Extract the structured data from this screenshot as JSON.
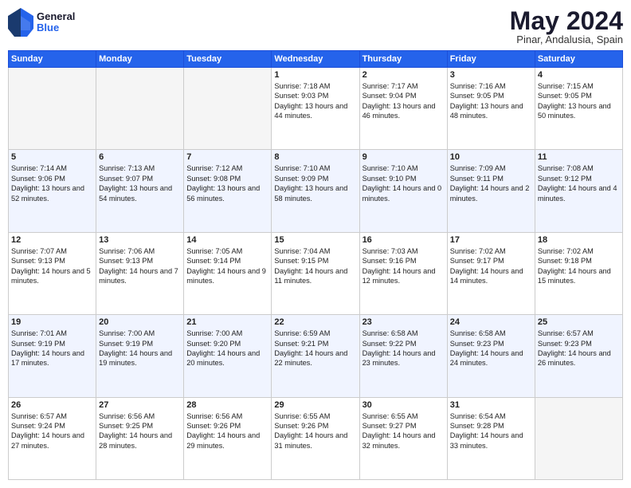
{
  "header": {
    "logo_general": "General",
    "logo_blue": "Blue",
    "title_month": "May 2024",
    "title_location": "Pinar, Andalusia, Spain"
  },
  "weekdays": [
    "Sunday",
    "Monday",
    "Tuesday",
    "Wednesday",
    "Thursday",
    "Friday",
    "Saturday"
  ],
  "weeks": [
    [
      {
        "day": "",
        "empty": true
      },
      {
        "day": "",
        "empty": true
      },
      {
        "day": "",
        "empty": true
      },
      {
        "day": "1",
        "rise": "Sunrise: 7:18 AM",
        "set": "Sunset: 9:03 PM",
        "light": "Daylight: 13 hours and 44 minutes."
      },
      {
        "day": "2",
        "rise": "Sunrise: 7:17 AM",
        "set": "Sunset: 9:04 PM",
        "light": "Daylight: 13 hours and 46 minutes."
      },
      {
        "day": "3",
        "rise": "Sunrise: 7:16 AM",
        "set": "Sunset: 9:05 PM",
        "light": "Daylight: 13 hours and 48 minutes."
      },
      {
        "day": "4",
        "rise": "Sunrise: 7:15 AM",
        "set": "Sunset: 9:05 PM",
        "light": "Daylight: 13 hours and 50 minutes."
      }
    ],
    [
      {
        "day": "5",
        "rise": "Sunrise: 7:14 AM",
        "set": "Sunset: 9:06 PM",
        "light": "Daylight: 13 hours and 52 minutes."
      },
      {
        "day": "6",
        "rise": "Sunrise: 7:13 AM",
        "set": "Sunset: 9:07 PM",
        "light": "Daylight: 13 hours and 54 minutes."
      },
      {
        "day": "7",
        "rise": "Sunrise: 7:12 AM",
        "set": "Sunset: 9:08 PM",
        "light": "Daylight: 13 hours and 56 minutes."
      },
      {
        "day": "8",
        "rise": "Sunrise: 7:10 AM",
        "set": "Sunset: 9:09 PM",
        "light": "Daylight: 13 hours and 58 minutes."
      },
      {
        "day": "9",
        "rise": "Sunrise: 7:10 AM",
        "set": "Sunset: 9:10 PM",
        "light": "Daylight: 14 hours and 0 minutes."
      },
      {
        "day": "10",
        "rise": "Sunrise: 7:09 AM",
        "set": "Sunset: 9:11 PM",
        "light": "Daylight: 14 hours and 2 minutes."
      },
      {
        "day": "11",
        "rise": "Sunrise: 7:08 AM",
        "set": "Sunset: 9:12 PM",
        "light": "Daylight: 14 hours and 4 minutes."
      }
    ],
    [
      {
        "day": "12",
        "rise": "Sunrise: 7:07 AM",
        "set": "Sunset: 9:13 PM",
        "light": "Daylight: 14 hours and 5 minutes."
      },
      {
        "day": "13",
        "rise": "Sunrise: 7:06 AM",
        "set": "Sunset: 9:13 PM",
        "light": "Daylight: 14 hours and 7 minutes."
      },
      {
        "day": "14",
        "rise": "Sunrise: 7:05 AM",
        "set": "Sunset: 9:14 PM",
        "light": "Daylight: 14 hours and 9 minutes."
      },
      {
        "day": "15",
        "rise": "Sunrise: 7:04 AM",
        "set": "Sunset: 9:15 PM",
        "light": "Daylight: 14 hours and 11 minutes."
      },
      {
        "day": "16",
        "rise": "Sunrise: 7:03 AM",
        "set": "Sunset: 9:16 PM",
        "light": "Daylight: 14 hours and 12 minutes."
      },
      {
        "day": "17",
        "rise": "Sunrise: 7:02 AM",
        "set": "Sunset: 9:17 PM",
        "light": "Daylight: 14 hours and 14 minutes."
      },
      {
        "day": "18",
        "rise": "Sunrise: 7:02 AM",
        "set": "Sunset: 9:18 PM",
        "light": "Daylight: 14 hours and 15 minutes."
      }
    ],
    [
      {
        "day": "19",
        "rise": "Sunrise: 7:01 AM",
        "set": "Sunset: 9:19 PM",
        "light": "Daylight: 14 hours and 17 minutes."
      },
      {
        "day": "20",
        "rise": "Sunrise: 7:00 AM",
        "set": "Sunset: 9:19 PM",
        "light": "Daylight: 14 hours and 19 minutes."
      },
      {
        "day": "21",
        "rise": "Sunrise: 7:00 AM",
        "set": "Sunset: 9:20 PM",
        "light": "Daylight: 14 hours and 20 minutes."
      },
      {
        "day": "22",
        "rise": "Sunrise: 6:59 AM",
        "set": "Sunset: 9:21 PM",
        "light": "Daylight: 14 hours and 22 minutes."
      },
      {
        "day": "23",
        "rise": "Sunrise: 6:58 AM",
        "set": "Sunset: 9:22 PM",
        "light": "Daylight: 14 hours and 23 minutes."
      },
      {
        "day": "24",
        "rise": "Sunrise: 6:58 AM",
        "set": "Sunset: 9:23 PM",
        "light": "Daylight: 14 hours and 24 minutes."
      },
      {
        "day": "25",
        "rise": "Sunrise: 6:57 AM",
        "set": "Sunset: 9:23 PM",
        "light": "Daylight: 14 hours and 26 minutes."
      }
    ],
    [
      {
        "day": "26",
        "rise": "Sunrise: 6:57 AM",
        "set": "Sunset: 9:24 PM",
        "light": "Daylight: 14 hours and 27 minutes."
      },
      {
        "day": "27",
        "rise": "Sunrise: 6:56 AM",
        "set": "Sunset: 9:25 PM",
        "light": "Daylight: 14 hours and 28 minutes."
      },
      {
        "day": "28",
        "rise": "Sunrise: 6:56 AM",
        "set": "Sunset: 9:26 PM",
        "light": "Daylight: 14 hours and 29 minutes."
      },
      {
        "day": "29",
        "rise": "Sunrise: 6:55 AM",
        "set": "Sunset: 9:26 PM",
        "light": "Daylight: 14 hours and 31 minutes."
      },
      {
        "day": "30",
        "rise": "Sunrise: 6:55 AM",
        "set": "Sunset: 9:27 PM",
        "light": "Daylight: 14 hours and 32 minutes."
      },
      {
        "day": "31",
        "rise": "Sunrise: 6:54 AM",
        "set": "Sunset: 9:28 PM",
        "light": "Daylight: 14 hours and 33 minutes."
      },
      {
        "day": "",
        "empty": true
      }
    ]
  ]
}
